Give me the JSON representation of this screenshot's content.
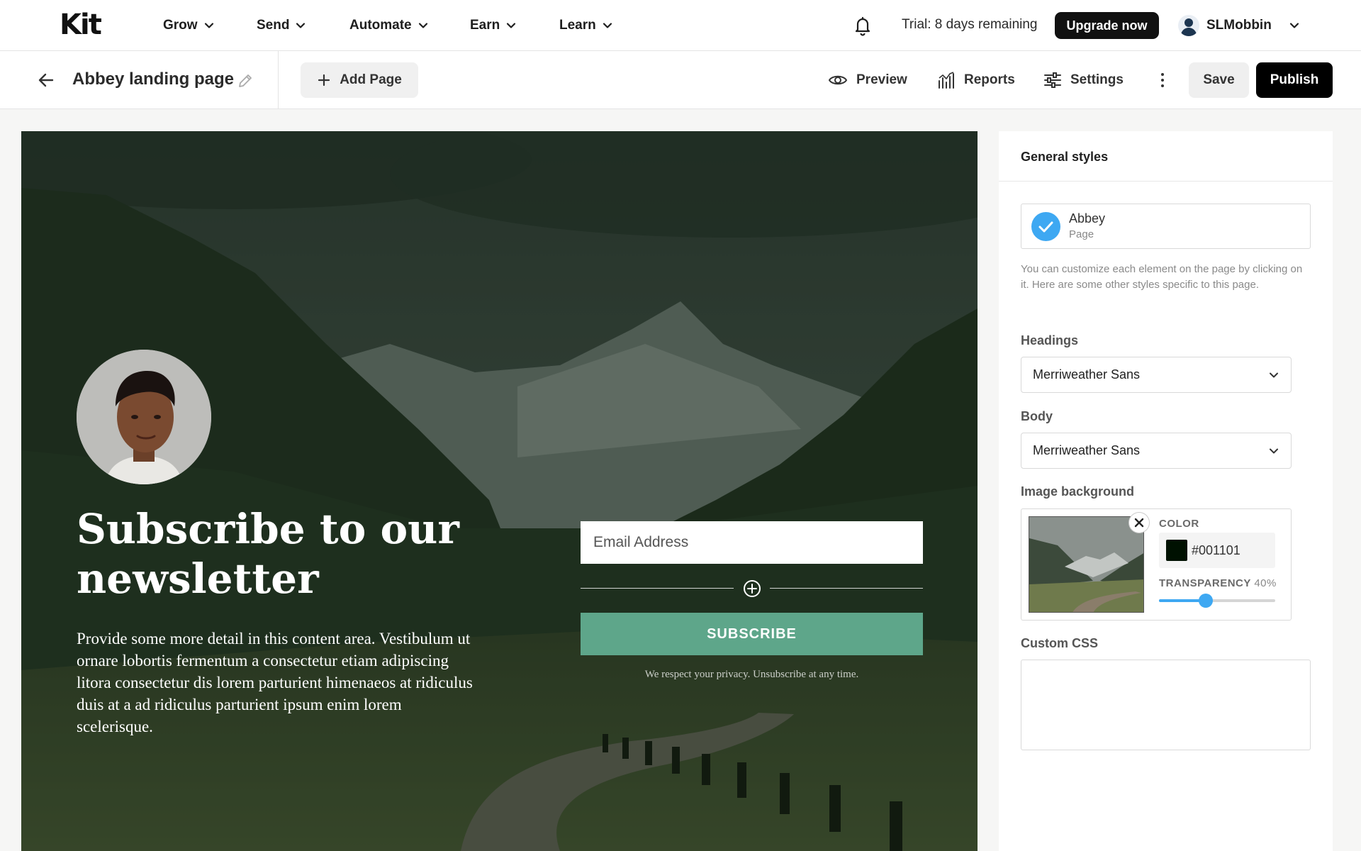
{
  "nav": {
    "logo": "Kit",
    "items": [
      {
        "label": "Grow"
      },
      {
        "label": "Send"
      },
      {
        "label": "Automate"
      },
      {
        "label": "Earn"
      },
      {
        "label": "Learn"
      }
    ],
    "trial_text": "Trial: 8 days remaining",
    "upgrade_label": "Upgrade now",
    "username": "SLMobbin",
    "icons": [
      "bell-icon",
      "user-avatar-icon",
      "chevron-down-icon"
    ]
  },
  "toolbar": {
    "page_title": "Abbey landing page",
    "add_page_label": "Add Page",
    "preview_label": "Preview",
    "reports_label": "Reports",
    "settings_label": "Settings",
    "save_label": "Save",
    "publish_label": "Publish",
    "icons": [
      "back-arrow-icon",
      "pencil-icon",
      "plus-icon",
      "eye-icon",
      "bar-chart-icon",
      "sliders-icon",
      "more-vertical-icon"
    ]
  },
  "canvas": {
    "headline": "Subscribe to our newsletter",
    "body": "Provide some more detail in this content area. Vestibulum ut ornare lobortis fermentum a consectetur etiam adipiscing litora consectetur dis lorem parturient himenaeos at ridiculus duis at a ad ridiculus parturient ipsum enim lorem scelerisque.",
    "email_placeholder": "Email Address",
    "subscribe_label": "SUBSCRIBE",
    "privacy_text": "We respect your privacy. Unsubscribe at any time.",
    "button_color": "#5ea68a"
  },
  "panel": {
    "title": "General styles",
    "theme": {
      "name": "Abbey",
      "type": "Page",
      "selected": true
    },
    "hint": "You can customize each element on the page by clicking on it. Here are some other styles specific to this page.",
    "headings_label": "Headings",
    "headings_font": "Merriweather Sans",
    "body_label": "Body",
    "body_font": "Merriweather Sans",
    "image_bg_label": "Image background",
    "color_label": "COLOR",
    "color_value": "#001101",
    "transparency_label": "TRANSPARENCY",
    "transparency_value": "40%",
    "transparency_fraction": 0.4,
    "custom_css_label": "Custom CSS",
    "custom_css_value": "",
    "accent_color": "#3ea8f2"
  }
}
